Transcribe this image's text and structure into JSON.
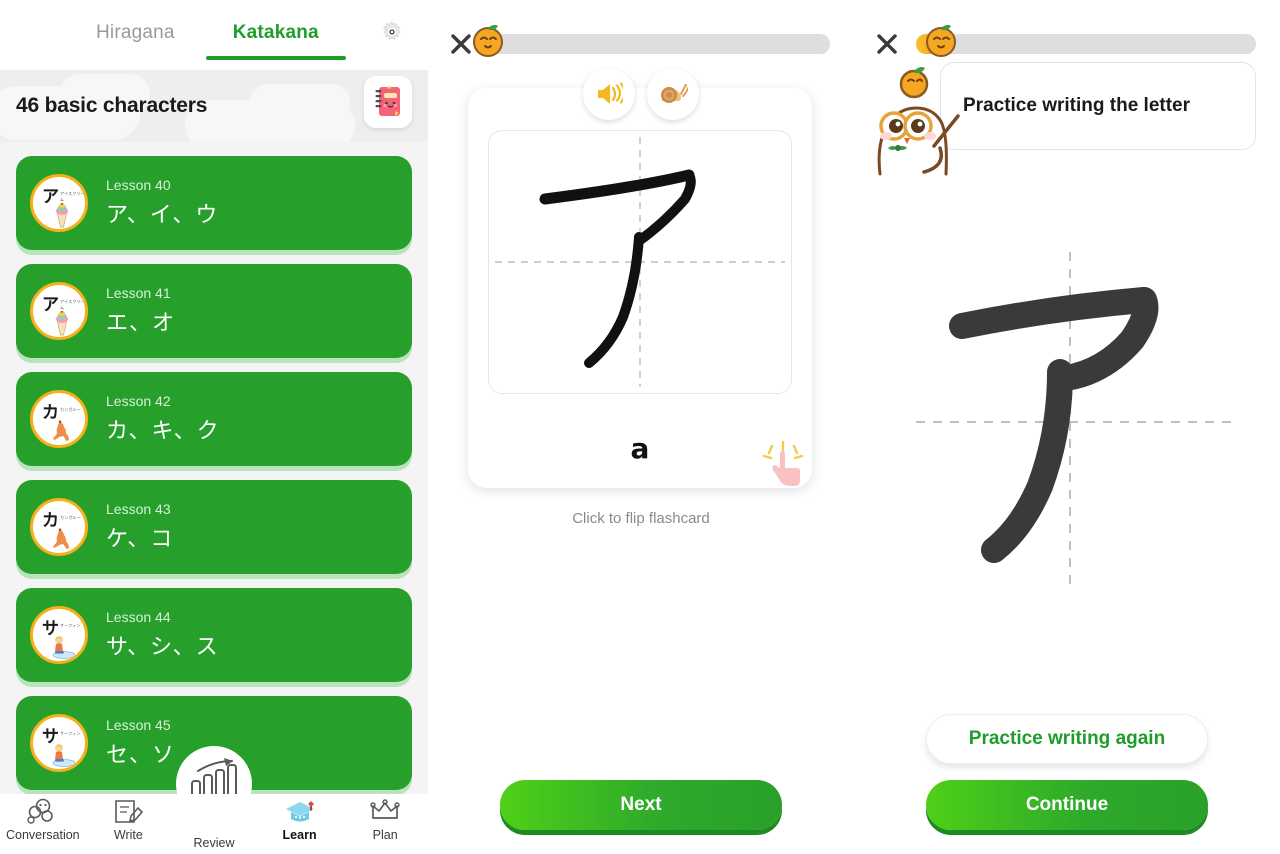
{
  "left_panel": {
    "tabs": [
      {
        "label": "Hiragana",
        "active": false
      },
      {
        "label": "Katakana",
        "active": true
      }
    ],
    "settings_icon": "gear-icon",
    "banner": {
      "title": "46 basic characters",
      "notebook_icon": "notebook-icon"
    },
    "lessons": [
      {
        "number": "Lesson 40",
        "characters": "ア、イ、ウ",
        "badge_kana": "ア",
        "badge_romaji": "アイスクリーム"
      },
      {
        "number": "Lesson 41",
        "characters": "エ、オ",
        "badge_kana": "ア",
        "badge_romaji": "アイスクリーム"
      },
      {
        "number": "Lesson 42",
        "characters": "カ、キ、ク",
        "badge_kana": "カ",
        "badge_romaji": "カンガルー"
      },
      {
        "number": "Lesson 43",
        "characters": "ケ、コ",
        "badge_kana": "カ",
        "badge_romaji": "カンガルー"
      },
      {
        "number": "Lesson 44",
        "characters": "サ、シ、ス",
        "badge_kana": "サ",
        "badge_romaji": "サーフィン"
      },
      {
        "number": "Lesson 45",
        "characters": "セ、ソ",
        "badge_kana": "サ",
        "badge_romaji": "サーフィン"
      }
    ],
    "bottom_nav": [
      {
        "label": "Conversation",
        "icon": "conversation-icon",
        "active": false
      },
      {
        "label": "Write",
        "icon": "write-icon",
        "active": false
      },
      {
        "label": "Review",
        "icon": "review-chart-icon",
        "active": false
      },
      {
        "label": "Learn",
        "icon": "graduation-cap-icon",
        "active": true
      },
      {
        "label": "Plan",
        "icon": "crown-icon",
        "active": false
      }
    ]
  },
  "middle_panel": {
    "close_label": "×",
    "progress_percent": 0,
    "mascot_icon": "orange-mascot-icon",
    "audio_buttons": [
      {
        "icon": "speaker-icon",
        "name": "play-audio-button"
      },
      {
        "icon": "snail-icon",
        "name": "play-slow-audio-button"
      }
    ],
    "flashcard": {
      "character": "ア",
      "romaji": "a",
      "hand_icon": "tap-hand-icon"
    },
    "flip_hint": "Click to flip flashcard",
    "next_button": "Next"
  },
  "right_panel": {
    "close_label": "×",
    "progress_percent": 8,
    "mascot_icon": "orange-mascot-icon",
    "teacher_icon": "orange-teacher-mascot-icon",
    "instruction": "Practice writing the letter",
    "character": "ア",
    "practice_again_button": "Practice writing again",
    "continue_button": "Continue"
  },
  "colors": {
    "green": "#26a02b",
    "green_bright": "#4fd017",
    "orange": "#f5a623",
    "yellow_ring": "#f5b01c",
    "gray_track": "#dedede",
    "stroke_dark": "#3a3a3a"
  }
}
